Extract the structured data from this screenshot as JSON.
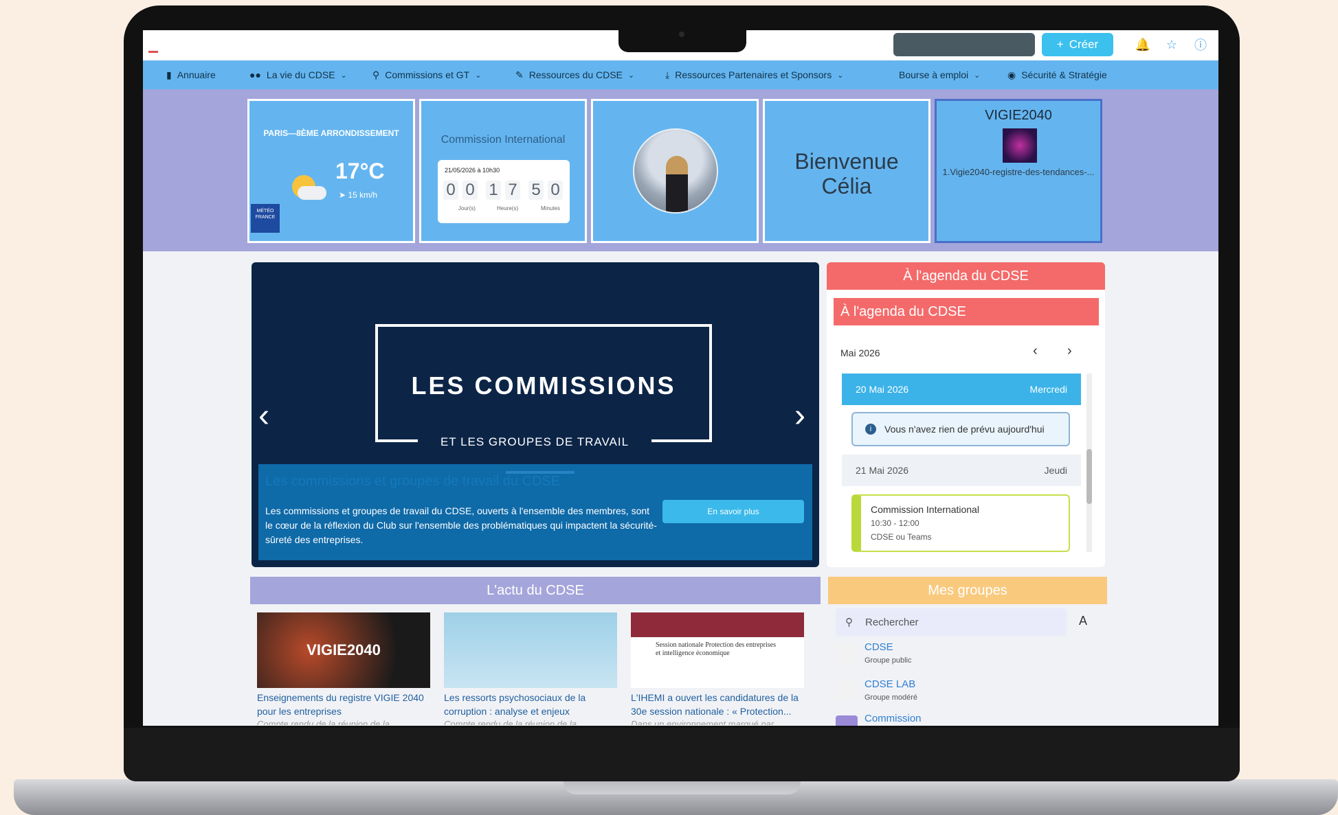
{
  "topbar": {
    "create_label": "Créer",
    "create_icon": "plus-icon",
    "bell_icon": "bell-icon",
    "star_icon": "star-icon",
    "help_icon": "help-icon"
  },
  "nav": {
    "items": [
      {
        "label": "Annuaire",
        "icon": "book-icon"
      },
      {
        "label": "La vie du CDSE",
        "icon": "users-icon"
      },
      {
        "label": "Commissions et GT",
        "icon": "search-icon"
      },
      {
        "label": "Ressources du CDSE",
        "icon": "pencil-icon"
      },
      {
        "label": "Ressources Partenaires et Sponsors",
        "icon": "download-icon"
      },
      {
        "label": "Bourse à emploi",
        "icon": ""
      },
      {
        "label": "Sécurité & Stratégie",
        "icon": "target-icon"
      }
    ]
  },
  "tiles": {
    "weather": {
      "location": "PARIS—8ÈME ARRONDISSEMENT",
      "temperature": "17°C",
      "wind": "15 km/h",
      "provider": "MÉTÉO FRANCE"
    },
    "countdown": {
      "title": "Commission International",
      "date": "21/05/2026 à 10h30",
      "digits": [
        "0",
        "0",
        "1",
        "7",
        "5",
        "0"
      ],
      "units": [
        "Jour(s)",
        "Heure(s)",
        "Minutes"
      ]
    },
    "welcome": {
      "line1": "Bienvenue",
      "line2": "Célia"
    },
    "vigie": {
      "title": "VIGIE2040",
      "file": "1.Vigie2040-registre-des-tendances-..."
    }
  },
  "carousel": {
    "title": "LES COMMISSIONS",
    "subtitle": "ET LES GROUPES DE TRAVAIL",
    "caption_title": "Les commissions et groupes de travail du CDSE",
    "caption_text": "Les commissions et groupes de travail du CDSE, ouverts à l'ensemble des membres, sont le cœur de la réflexion du Club sur l'ensemble des problématiques qui impactent la sécurité-sûreté des entreprises.",
    "button": "En savoir plus"
  },
  "agenda": {
    "header": "À l'agenda du CDSE",
    "subheader": "À l'agenda du CDSE",
    "month": "Mai 2026",
    "day1": {
      "date": "20 Mai 2026",
      "weekday": "Mercredi"
    },
    "note": "Vous n'avez rien de prévu aujourd'hui",
    "day2": {
      "date": "21 Mai 2026",
      "weekday": "Jeudi"
    },
    "event": {
      "title": "Commission International",
      "time": "10:30 - 12:00",
      "place": "CDSE ou Teams"
    }
  },
  "actu": {
    "header": "L'actu du CDSE",
    "cards": [
      {
        "title": "Enseignements du registre VIGIE 2040 pour les entreprises",
        "desc": "Compte rendu de la réunion de la",
        "image_label": "VIGIE2040"
      },
      {
        "title": "Les ressorts psychosociaux de la corruption : analyse et enjeux",
        "desc": "Compte rendu de la réunion de la",
        "image_label": ""
      },
      {
        "title": "L'IHEMI a ouvert les candidatures de la 30e session nationale : « Protection...",
        "desc": "Dans un environnement marqué par",
        "image_label": "Session nationale Protection des entreprises et intelligence économique"
      }
    ]
  },
  "groups": {
    "header": "Mes groupes",
    "search_placeholder": "Rechercher",
    "items": [
      {
        "name": "CDSE",
        "type": "Groupe public"
      },
      {
        "name": "CDSE LAB",
        "type": "Groupe modéré"
      },
      {
        "name": "Commission",
        "type": ""
      }
    ]
  },
  "colors": {
    "nav": "#64b5ef",
    "band": "#a4a5da",
    "agenda": "#f46a6a",
    "groups": "#f9c97d",
    "carousel": "#0c2547"
  }
}
